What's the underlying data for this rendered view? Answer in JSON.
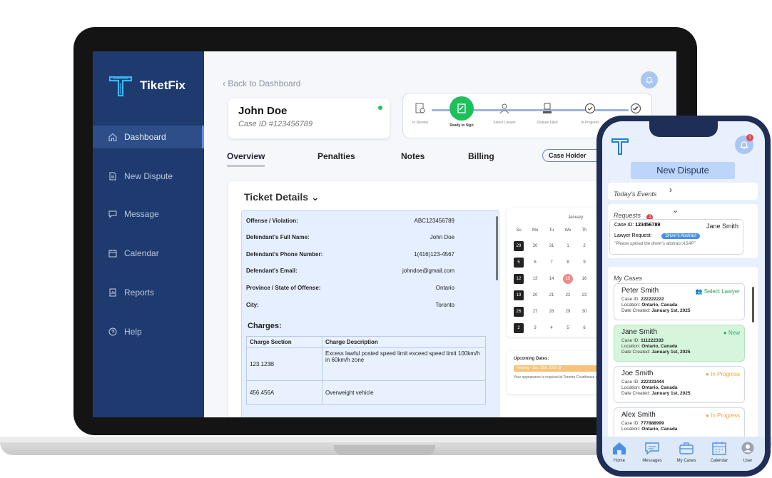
{
  "laptop": {
    "brand": "TiketFix",
    "nav": [
      {
        "label": "Dashboard",
        "icon": "home-icon"
      },
      {
        "label": "New Dispute",
        "icon": "document-icon"
      },
      {
        "label": "Message",
        "icon": "chat-icon"
      },
      {
        "label": "Calendar",
        "icon": "calendar-icon"
      },
      {
        "label": "Reports",
        "icon": "report-icon"
      },
      {
        "label": "Help",
        "icon": "help-icon"
      }
    ],
    "back_link": "Back to Dashboard",
    "client": {
      "name": "John Doe",
      "case_id": "Case ID #123456789"
    },
    "steps": [
      {
        "label": "In Review"
      },
      {
        "label": "Ready to Sign"
      },
      {
        "label": "Select Lawyer"
      },
      {
        "label": "Dispute Filed"
      },
      {
        "label": "In Progress"
      },
      {
        "label": ""
      }
    ],
    "tabs": [
      "Overview",
      "Penalties",
      "Notes",
      "Billing"
    ],
    "holder_pill": "Case Holder",
    "details": {
      "title": "Ticket Details",
      "fields": [
        {
          "label": "Offense / Violation:",
          "value": "ABC123456789"
        },
        {
          "label": "Defendant's Full Name:",
          "value": "John Doe"
        },
        {
          "label": "Defendant's Phone Number:",
          "value": "1(416)123-4567"
        },
        {
          "label": "Defendant's Email:",
          "value": "johndoe@gmail.com"
        },
        {
          "label": "Province / State of Offense:",
          "value": "Ontario"
        },
        {
          "label": "City:",
          "value": "Toronto"
        }
      ],
      "charges_title": "Charges:",
      "charges_headers": [
        "Charge Section",
        "Charge Description"
      ],
      "charges_rows": [
        {
          "section": "123.123B",
          "description": "Excess lawful posted speed limit exceed speed limit 100km/h in 60km/h zone"
        },
        {
          "section": "456.456A",
          "description": "Overweight vehicle"
        }
      ]
    },
    "calendar": {
      "month": "January",
      "weekdays": [
        "Su",
        "Mo",
        "Tu",
        "We",
        "Th"
      ],
      "rows": [
        [
          "29",
          "30",
          "31",
          "1",
          "2"
        ],
        [
          "5",
          "6",
          "7",
          "8",
          "9"
        ],
        [
          "12",
          "13",
          "14",
          "15",
          "16"
        ],
        [
          "19",
          "20",
          "21",
          "22",
          "23"
        ],
        [
          "26",
          "27",
          "28",
          "29",
          "30"
        ],
        [
          "2",
          "3",
          "4",
          "5",
          "6"
        ]
      ]
    },
    "upcoming": {
      "title": "Upcoming Dates:",
      "pill": "Hearing - Jan. 15th, 2025 @",
      "note": "Your appearance is required at Toronto Courthouse a..."
    }
  },
  "phone": {
    "new_dispute": "New Dispute",
    "notification_count": "1",
    "todays_events": "Today's Events",
    "requests": {
      "title": "Requests",
      "count": "1",
      "case_id_label": "Case ID:",
      "case_id": "123456789",
      "name": "Jane Smith",
      "lawyer_request_label": "Lawyer Request:",
      "badge": "Driver's Abstract",
      "message": "\"Please upload the driver's abstract ASAP\""
    },
    "my_cases_title": "My Cases",
    "cases": [
      {
        "name": "Peter Smith",
        "status": "Select Lawyer",
        "status_color": "#2f9e5b",
        "case_id": "222222222",
        "location": "Ontario, Canada",
        "date": "January 1st, 2025"
      },
      {
        "name": "Jane Smith",
        "status": "New",
        "status_color": "#2fae5f",
        "case_id": "111222333",
        "location": "Ontario, Canada",
        "date": "January 1st, 2025"
      },
      {
        "name": "Joe Smith",
        "status": "In Progress",
        "status_color": "#f0a23a",
        "case_id": "222333444",
        "location": "Ontario, Canada",
        "date": "January 1st, 2025"
      },
      {
        "name": "Alex Smith",
        "status": "In Progress",
        "status_color": "#f0a23a",
        "case_id": "777888999",
        "location": "Ontario, Canada",
        "date": ""
      }
    ],
    "case_labels": {
      "case_id": "Case ID:",
      "location": "Location:",
      "date": "Date Created:"
    },
    "tabbar": [
      {
        "label": "Home",
        "icon": "home-icon"
      },
      {
        "label": "Messages",
        "icon": "chat-icon"
      },
      {
        "label": "My Cases",
        "icon": "briefcase-icon"
      },
      {
        "label": "Calendar",
        "icon": "calendar-icon"
      },
      {
        "label": "User",
        "icon": "user-icon"
      }
    ]
  },
  "colors": {
    "sidebar": "#1e3a6e",
    "accent": "#4a90e2",
    "success": "#1fbf5c",
    "warning": "#f0a23a"
  }
}
